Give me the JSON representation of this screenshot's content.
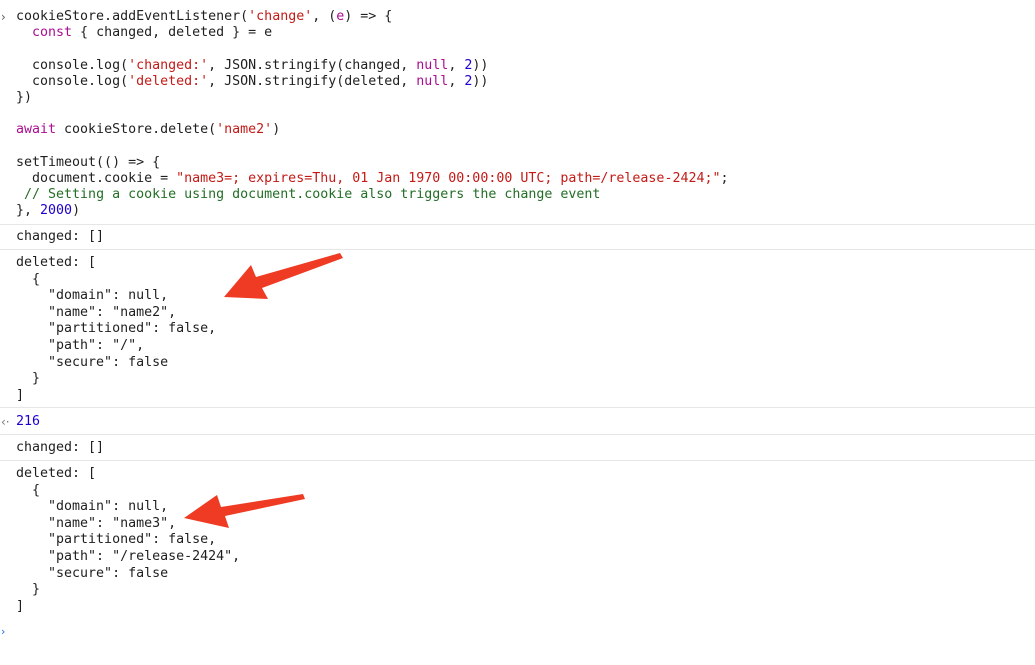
{
  "input": {
    "lines": [
      [
        {
          "t": "cookieStore.addEventListener("
        },
        {
          "t": "'change'",
          "c": "str"
        },
        {
          "t": ", ("
        },
        {
          "t": "e",
          "c": "kw"
        },
        {
          "t": ") => {"
        }
      ],
      [
        {
          "t": "  "
        },
        {
          "t": "const",
          "c": "kw"
        },
        {
          "t": " { changed, deleted } = e"
        }
      ],
      [
        {
          "t": ""
        }
      ],
      [
        {
          "t": "  console.log("
        },
        {
          "t": "'changed:'",
          "c": "str"
        },
        {
          "t": ", JSON.stringify(changed, "
        },
        {
          "t": "null",
          "c": "kw"
        },
        {
          "t": ", "
        },
        {
          "t": "2",
          "c": "num"
        },
        {
          "t": "))"
        }
      ],
      [
        {
          "t": "  console.log("
        },
        {
          "t": "'deleted:'",
          "c": "str"
        },
        {
          "t": ", JSON.stringify(deleted, "
        },
        {
          "t": "null",
          "c": "kw"
        },
        {
          "t": ", "
        },
        {
          "t": "2",
          "c": "num"
        },
        {
          "t": "))"
        }
      ],
      [
        {
          "t": "})"
        }
      ],
      [
        {
          "t": ""
        }
      ],
      [
        {
          "t": "await",
          "c": "kw"
        },
        {
          "t": " cookieStore.delete("
        },
        {
          "t": "'name2'",
          "c": "str"
        },
        {
          "t": ")"
        }
      ],
      [
        {
          "t": ""
        }
      ],
      [
        {
          "t": "setTimeout(() => {"
        }
      ],
      [
        {
          "t": "  document.cookie = "
        },
        {
          "t": "\"name3=; expires=Thu, 01 Jan 1970 00:00:00 UTC; path=/release-2424;\"",
          "c": "str"
        },
        {
          "t": ";"
        }
      ],
      [
        {
          "t": " "
        },
        {
          "t": "// Setting a cookie using document.cookie also triggers the change event",
          "c": "com"
        }
      ],
      [
        {
          "t": "}, "
        },
        {
          "t": "2000",
          "c": "num"
        },
        {
          "t": ")"
        }
      ]
    ]
  },
  "logs": {
    "changed_1": "changed: []",
    "deleted_1": [
      "deleted: [",
      "  {",
      "    \"domain\": null,",
      "    \"name\": \"name2\",",
      "    \"partitioned\": false,",
      "    \"path\": \"/\",",
      "    \"secure\": false",
      "  }",
      "]"
    ],
    "result_value": "216",
    "changed_2": "changed: []",
    "deleted_2": [
      "deleted: [",
      "  {",
      "    \"domain\": null,",
      "    \"name\": \"name3\",",
      "    \"partitioned\": false,",
      "    \"path\": \"/release-2424\",",
      "    \"secure\": false",
      "  }",
      "]"
    ]
  },
  "glyphs": {
    "prompt": "›",
    "result": "‹·",
    "empty_prompt": "›"
  },
  "colors": {
    "arrow": "#ef3b24",
    "keyword": "#aa0d91",
    "string": "#c41a16",
    "number": "#1c00cf",
    "comment": "#236e25"
  }
}
